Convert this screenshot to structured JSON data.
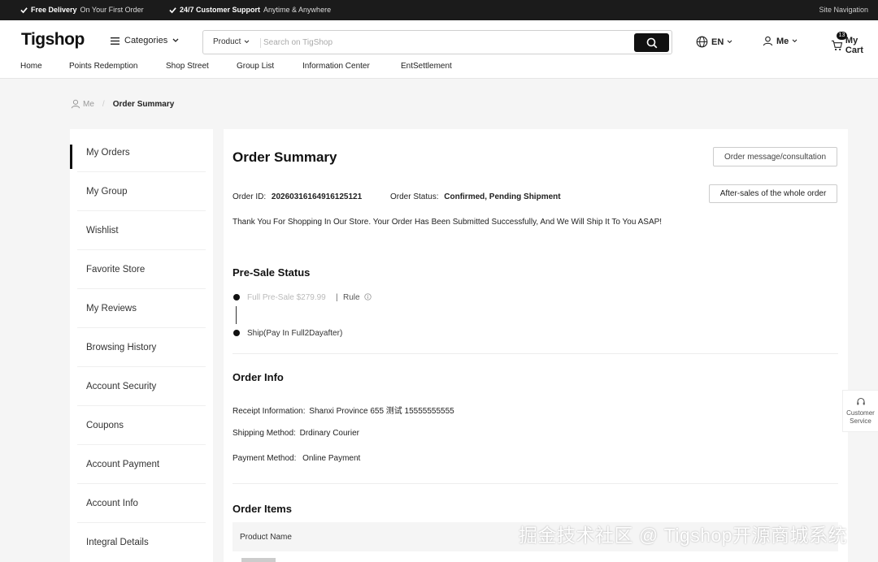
{
  "topbar": {
    "promo1_bold": "Free Delivery",
    "promo1_text": "On Your First Order",
    "promo2_bold": "24/7 Customer Support",
    "promo2_text": "Anytime & Anywhere",
    "site_nav": "Site Navigation"
  },
  "header": {
    "logo": "Tigshop",
    "categories": "Categories",
    "search_scope": "Product",
    "search_placeholder": "Search on TigShop",
    "language": "EN",
    "me": "Me",
    "cart_label": "My Cart",
    "cart_count": "13"
  },
  "nav": [
    "Home",
    "Points Redemption",
    "Shop Street",
    "Group List",
    "Information Center",
    "EntSettlement"
  ],
  "breadcrumb": {
    "root": "Me",
    "current": "Order Summary"
  },
  "sidebar": [
    "My Orders",
    "My Group",
    "Wishlist",
    "Favorite Store",
    "My Reviews",
    "Browsing History",
    "Account Security",
    "Coupons",
    "Account Payment",
    "Account Info",
    "Integral Details"
  ],
  "order": {
    "title": "Order Summary",
    "message_button": "Order message/consultation",
    "aftersales_button": "After-sales of the whole order",
    "id_label": "Order ID:",
    "id_value": "20260316164916125121",
    "status_label": "Order Status:",
    "status_value": "Confirmed, Pending Shipment",
    "thanks": "Thank You For Shopping In Our Store. Your Order Has Been Submitted Successfully, And We Will Ship It To You ASAP!"
  },
  "presale": {
    "title": "Pre-Sale Status",
    "step1": "Full Pre-Sale $279.99",
    "separator": "|",
    "rule": "Rule",
    "step2": "Ship(Pay In Full2Dayafter)"
  },
  "info": {
    "title": "Order Info",
    "receipt_label": "Receipt Information:",
    "receipt_value": "Shanxi Province 655 测试 15555555555",
    "shipping_label": "Shipping Method:",
    "shipping_value": "Drdinary Courier",
    "payment_label": "Payment Method:",
    "payment_value": "Online Payment"
  },
  "items": {
    "title": "Order Items",
    "col_product": "Product Name"
  },
  "customer_service": {
    "line1": "Customer",
    "line2": "Service"
  },
  "watermark": "掘金技术社区 @ Tigshop开源商城系统"
}
